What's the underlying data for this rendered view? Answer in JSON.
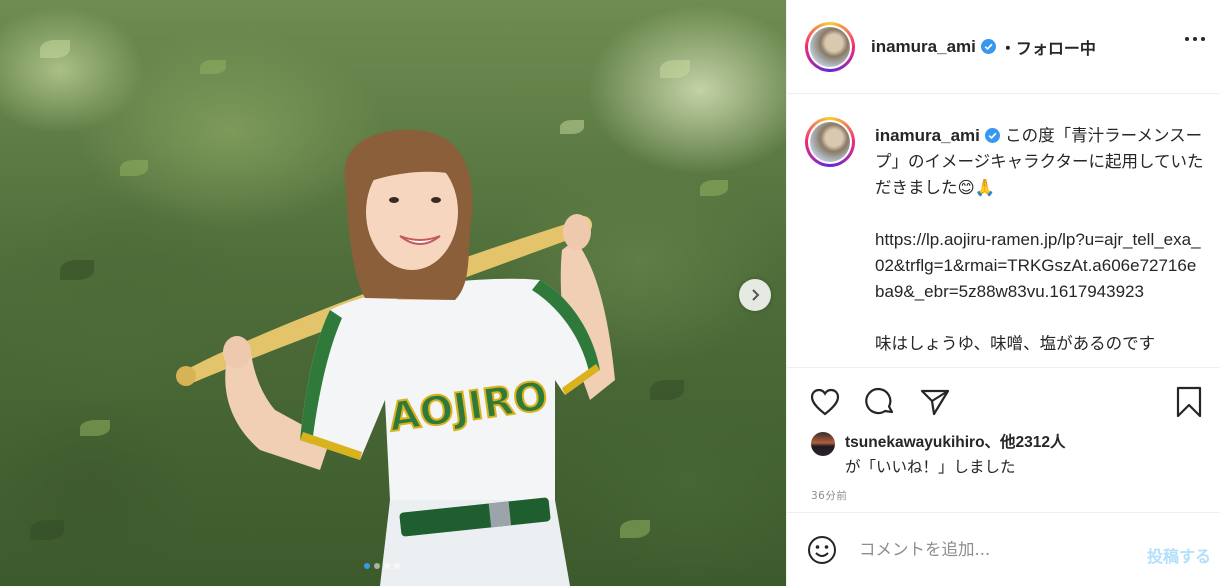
{
  "post": {
    "username": "inamura_ami",
    "follow_status": "・フォロー中",
    "more_icon": "more-horizontal-icon"
  },
  "caption": {
    "username": "inamura_ami",
    "line1": "この度「青汁ラーメンスープ」のイメージキャラクターに起用していただきました😊🙏",
    "url": "https://lp.aojiru-ramen.jp/lp?u=ajr_tell_exa_02&trflg=1&rmai=TRKGszAt.a606e72716eba9&_ebr=5z88w83vu.1617943923",
    "line2": "味はしょうゆ、味噌、塩があるのです"
  },
  "photo": {
    "jersey_text": "AOJIRO",
    "carousel_dots": 4,
    "active_dot": 0
  },
  "actions": {
    "icons": [
      "heart-icon",
      "comment-icon",
      "share-icon",
      "bookmark-icon"
    ]
  },
  "likes": {
    "liker": "tsunekawayukihiro",
    "others": "、他2312人",
    "suffix": "が「いいね！」しました"
  },
  "timestamp": "36分前",
  "comment": {
    "placeholder": "コメントを追加...",
    "post_label": "投稿する"
  },
  "colors": {
    "link_blue": "#3897f0",
    "post_disabled": "#b2dffc",
    "verified": "#3897f0",
    "jersey_green": "#2f7a3a",
    "jersey_gold": "#d9b21c"
  }
}
